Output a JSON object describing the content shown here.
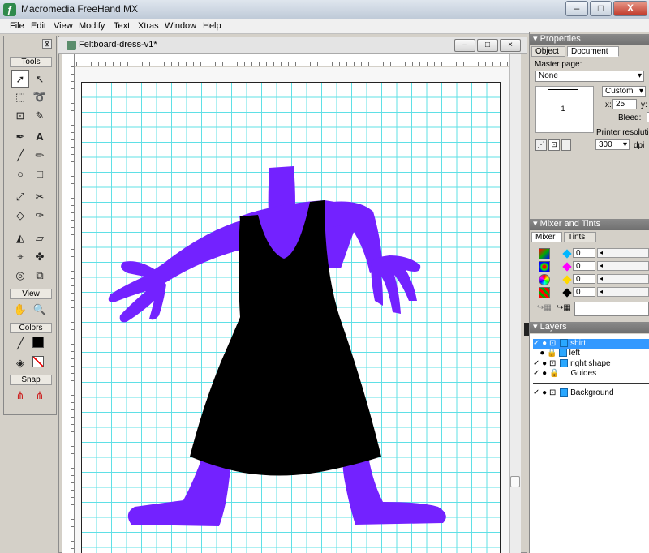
{
  "window": {
    "title": "Macromedia FreeHand MX",
    "minimize": "–",
    "maximize": "□",
    "close": "X"
  },
  "menu": [
    "File",
    "Edit",
    "View",
    "Modify",
    "Text",
    "Xtras",
    "Window",
    "Help"
  ],
  "tools_panel": {
    "title": "Tools",
    "view_label": "View",
    "colors_label": "Colors",
    "snap_label": "Snap",
    "close": "⊠"
  },
  "document": {
    "title": "Feltboard-dress-v1*",
    "minimize": "–",
    "maximize": "□",
    "close": "×"
  },
  "properties": {
    "panel_title": "Properties",
    "tabs": [
      "Object",
      "Document"
    ],
    "active_tab": "Document",
    "master_page_label": "Master page:",
    "master_page_value": "None",
    "page_size_value": "Custom",
    "page_number": "1",
    "x_label": "x:",
    "x_value": "25",
    "y_label": "y:",
    "bleed_label": "Bleed:",
    "printer_res_label": "Printer resolution:",
    "printer_res_value": "300",
    "dpi_label": "dpi"
  },
  "mixer": {
    "panel_title": "Mixer and Tints",
    "tabs": [
      "Mixer",
      "Tints"
    ],
    "active_tab": "Mixer",
    "channels": [
      {
        "name": "cyan",
        "value": "0",
        "color": "#00b7ff"
      },
      {
        "name": "magenta",
        "value": "0",
        "color": "#ff00ff"
      },
      {
        "name": "yellow",
        "value": "0",
        "color": "#ffd800"
      },
      {
        "name": "black",
        "value": "0",
        "color": "#000000"
      }
    ]
  },
  "layers": {
    "panel_title": "Layers",
    "items": [
      {
        "name": "shirt",
        "selected": true
      },
      {
        "name": "left",
        "selected": false
      },
      {
        "name": "right shape",
        "selected": false
      },
      {
        "name": "Guides",
        "selected": false
      },
      {
        "name": "Background",
        "selected": false
      }
    ]
  },
  "colors": {
    "figure": "#7322ff",
    "dress": "#000000",
    "grid": "#5fe0e6",
    "layer_swatch": "#29a7ff",
    "selection": "#3399ff"
  }
}
